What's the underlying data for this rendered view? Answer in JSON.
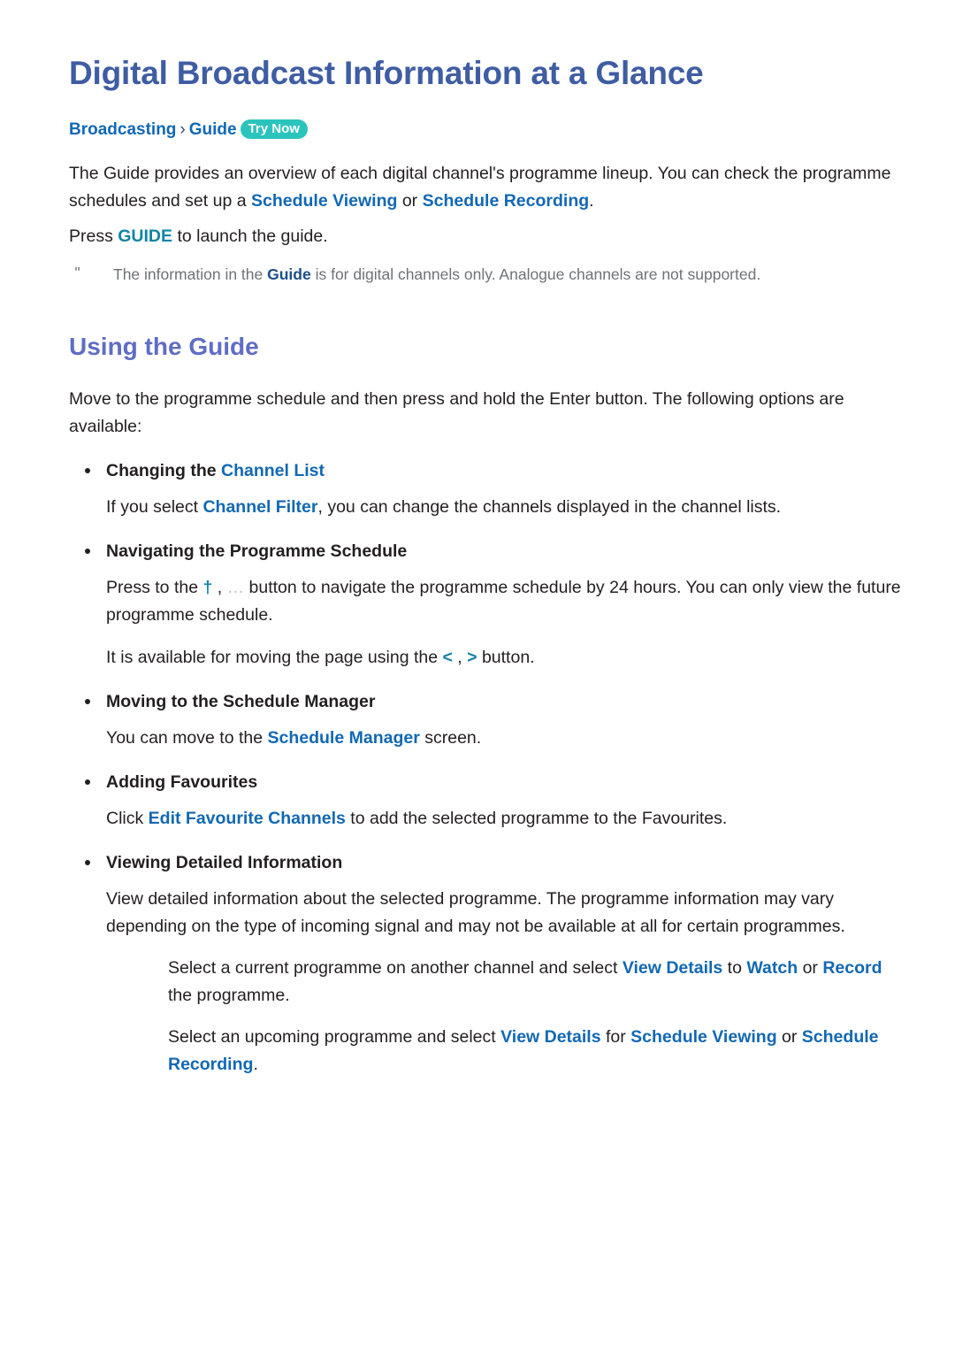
{
  "document": {
    "title": "Digital Broadcast Information at a Glance",
    "breadcrumb": {
      "root": "Broadcasting",
      "separator": "›",
      "leaf": "Guide",
      "badge": "Try Now"
    },
    "intro": {
      "p1_part1": "The Guide provides an overview of each digital channel's programme lineup. You can check the",
      "p1_part2": "programme schedules and set up a ",
      "p1_key1": "Schedule Viewing",
      "p1_part3": " or ",
      "p1_key2": "Schedule Recording",
      "p1_part4": ".",
      "p2_part1": "Press ",
      "p2_key": "GUIDE",
      "p2_part2": " to launch the guide."
    },
    "note": {
      "marker": "\"",
      "part1": "The information in the ",
      "key": "Guide",
      "part2": " is for digital channels only. Analogue channels are not supported."
    },
    "section": {
      "heading": "Using the Guide",
      "intro": "Move to the programme schedule and then press and hold the Enter button. The following options are available:"
    },
    "options": [
      {
        "label_prefix": "Changing the ",
        "label_key": "Channel List",
        "label_suffix": "",
        "body": {
          "part1": "If you select ",
          "key1": "Channel Filter",
          "part2": ", you can change the channels displayed in the channel lists."
        }
      },
      {
        "label_prefix": "Navigating the Programme Schedule",
        "label_key": "",
        "label_suffix": "",
        "body": {
          "part1": "Press to the ",
          "glyph1": "†",
          "part2": " , ",
          "glyph2": "…",
          "part3": " button to navigate the programme schedule by 24 hours. You can only view the future programme schedule."
        },
        "body2": {
          "part1": "It is available for moving the page using the ",
          "glyph1": "<",
          "part2": " , ",
          "glyph2": ">",
          "part3": "  button."
        }
      },
      {
        "label_prefix": "Moving to the Schedule Manager",
        "label_key": "",
        "label_suffix": "",
        "body": {
          "part1": "You can move to the ",
          "key1": "Schedule Manager",
          "part2": " screen."
        }
      },
      {
        "label_prefix": "Adding Favourites",
        "label_key": "",
        "label_suffix": "",
        "body": {
          "part1": "Click ",
          "key1": "Edit Favourite Channels",
          "part2": " to add the selected programme to the Favourites."
        }
      },
      {
        "label_prefix": "Viewing Detailed Information",
        "label_key": "",
        "label_suffix": "",
        "body": {
          "part1": "View detailed information about the selected programme. The programme information may vary depending on the type of incoming signal and may not be available at all for certain programmes."
        },
        "sub1": {
          "part1": "Select a current programme on another channel and select ",
          "key1": "View Details",
          "part2": " to ",
          "key2": "Watch",
          "part3": " or ",
          "key3": "Record",
          "part4": " the programme."
        },
        "sub2": {
          "part1": "Select an upcoming programme and select ",
          "key1": "View Details",
          "part2": " for ",
          "key2": "Schedule Viewing",
          "part3": " or ",
          "key3": "Schedule Recording",
          "part4": "."
        }
      }
    ],
    "colors": {
      "title": "#3f5da3",
      "section_heading": "#5f6dc4",
      "link_blue": "#1268b3",
      "key_teal": "#0f84a6",
      "badge_teal": "#2bc4bd",
      "body_text": "#231f20",
      "note_text": "#6f7276"
    }
  }
}
